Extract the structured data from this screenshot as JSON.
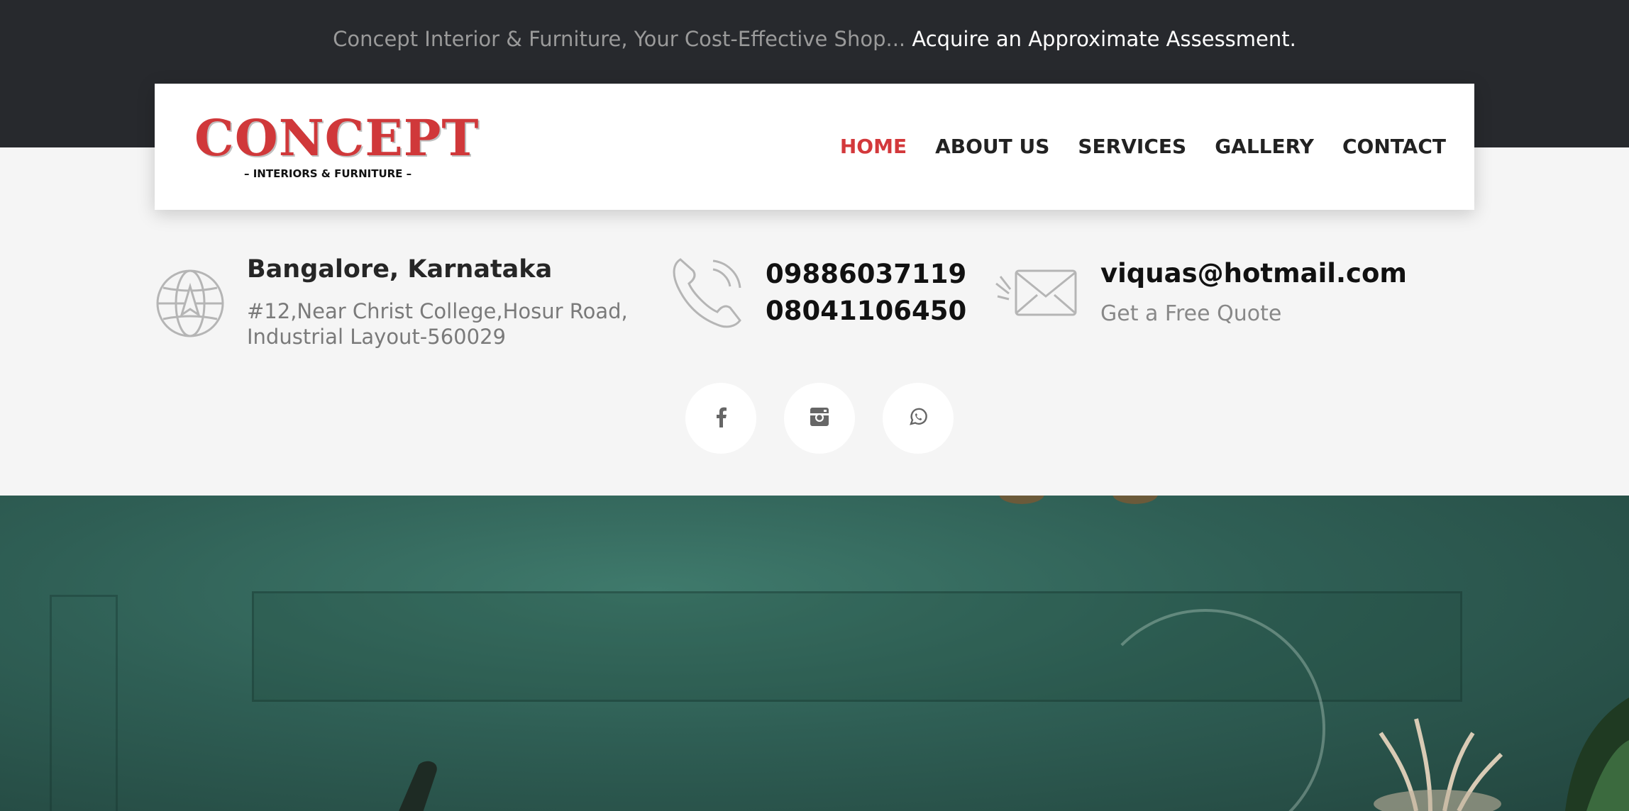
{
  "topbar": {
    "tagline": "Concept Interior & Furniture, Your Cost-Effective Shop...",
    "cta": "Acquire an Approximate Assessment."
  },
  "logo": {
    "main": "CONCEPT",
    "sub": "– INTERIORS & FURNITURE –"
  },
  "nav": {
    "items": [
      {
        "label": "HOME",
        "active": true
      },
      {
        "label": "ABOUT US"
      },
      {
        "label": "SERVICES"
      },
      {
        "label": "GALLERY"
      },
      {
        "label": "CONTACT"
      }
    ]
  },
  "address": {
    "title": "Bangalore, Karnataka",
    "line1": "#12,Near Christ College,Hosur Road,",
    "line2": "Industrial Layout-560029",
    "icon": "globe-icon"
  },
  "phones": {
    "numbers": [
      "09886037119",
      "08041106450"
    ],
    "icon": "phone-icon"
  },
  "email": {
    "address": "viquas@hotmail.com",
    "quote_label": "Get a Free Quote",
    "icon": "mail-icon"
  },
  "social": [
    {
      "name": "facebook",
      "icon": "facebook-icon"
    },
    {
      "name": "instagram",
      "icon": "instagram-icon"
    },
    {
      "name": "whatsapp",
      "icon": "whatsapp-icon"
    }
  ],
  "colors": {
    "accent": "#d3383b",
    "topbar": "#27292d",
    "hero": "#2f5f55"
  }
}
